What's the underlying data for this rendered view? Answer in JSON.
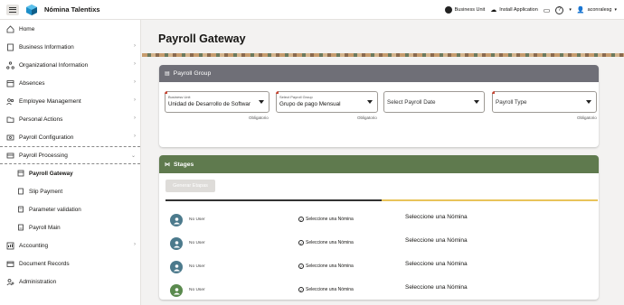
{
  "app": {
    "title": "Nómina Talentixs"
  },
  "topbar": {
    "business_unit": "Business Unit",
    "install_app": "Install Application",
    "user": "aconralesg"
  },
  "sidebar": {
    "items": [
      {
        "label": "Home",
        "icon": "home-icon"
      },
      {
        "label": "Business Information",
        "icon": "building-icon"
      },
      {
        "label": "Organizational Information",
        "icon": "org-chart-icon"
      },
      {
        "label": "Absences",
        "icon": "calendar-icon"
      },
      {
        "label": "Employee Management",
        "icon": "employees-icon"
      },
      {
        "label": "Personal Actions",
        "icon": "folder-icon"
      },
      {
        "label": "Payroll Configuration",
        "icon": "config-icon"
      },
      {
        "label": "Payroll Processing",
        "icon": "payroll-icon"
      }
    ],
    "subitems": [
      {
        "label": "Payroll Gateway",
        "icon": "gateway-icon"
      },
      {
        "label": "Slip Payment",
        "icon": "slip-icon"
      },
      {
        "label": "Parameter validation",
        "icon": "parameter-icon"
      },
      {
        "label": "Payroll Main",
        "icon": "payroll-main-icon"
      }
    ],
    "bottom_items": [
      {
        "label": "Accounting",
        "icon": "accounting-icon"
      },
      {
        "label": "Document Records",
        "icon": "document-icon"
      },
      {
        "label": "Administration",
        "icon": "admin-icon"
      }
    ]
  },
  "main": {
    "page_title": "Payroll Gateway",
    "payroll_group": {
      "title": "Payroll Group",
      "business_unit_label": "Business Unit",
      "business_unit_value": "Unidad de Desarrollo de Softwar",
      "payroll_group_label": "Select Payroll Group",
      "payroll_group_value": "Grupo de pago Mensual",
      "payroll_date_placeholder": "Select Payroll Date",
      "payroll_type_placeholder": "Payroll Type",
      "required": "Obligatorio"
    },
    "stages": {
      "title": "Stages",
      "generate_button": "Generar Etapas",
      "progress": 0.5,
      "rows": [
        {
          "user": "No User",
          "check_label": "Seleccione una Nómina",
          "text": "Seleccione una Nómina",
          "avatar_color": "#4c7a8c"
        },
        {
          "user": "No User",
          "check_label": "Seleccione una Nómina",
          "text": "Seleccione una Nómina",
          "avatar_color": "#4c7a8c"
        },
        {
          "user": "No User",
          "check_label": "Seleccione una Nómina",
          "text": "Seleccione una Nómina",
          "avatar_color": "#4c7a8c"
        },
        {
          "user": "No User",
          "check_label": "Seleccione una Nómina",
          "text": "Seleccione una Nómina",
          "avatar_color": "#5a8a4e"
        }
      ]
    }
  }
}
